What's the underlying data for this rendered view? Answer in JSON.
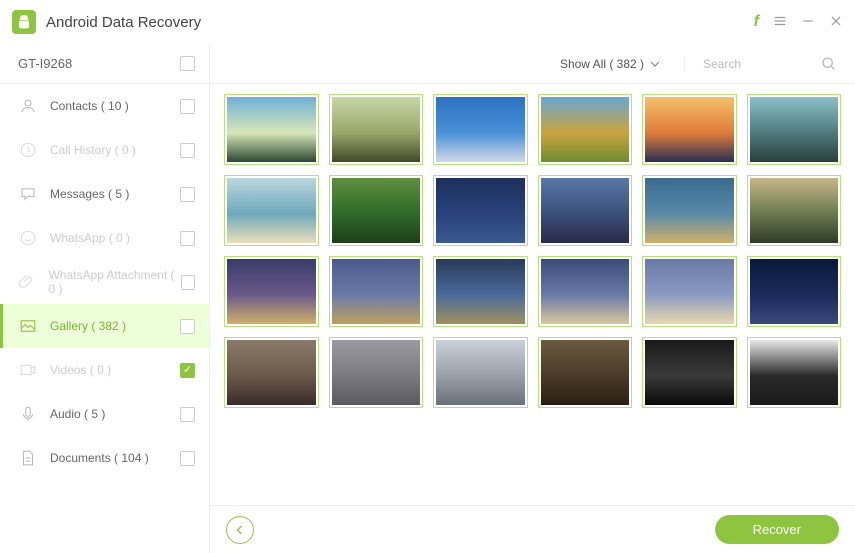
{
  "app": {
    "title": "Android Data Recovery"
  },
  "device": {
    "name": "GT-I9268",
    "checked": false
  },
  "sidebar": {
    "items": [
      {
        "label": "Contacts ( 10 )",
        "icon": "contacts",
        "disabled": false,
        "active": false,
        "checked": false
      },
      {
        "label": "Call History ( 0 )",
        "icon": "call-history",
        "disabled": true,
        "active": false,
        "checked": false
      },
      {
        "label": "Messages ( 5 )",
        "icon": "messages",
        "disabled": false,
        "active": false,
        "checked": false
      },
      {
        "label": "WhatsApp ( 0 )",
        "icon": "whatsapp",
        "disabled": true,
        "active": false,
        "checked": false
      },
      {
        "label": "WhatsApp Attachment ( 0 )",
        "icon": "attachment",
        "disabled": true,
        "active": false,
        "checked": false
      },
      {
        "label": "Gallery ( 382 )",
        "icon": "gallery",
        "disabled": false,
        "active": true,
        "checked": false
      },
      {
        "label": "Videos ( 0 )",
        "icon": "videos",
        "disabled": true,
        "active": false,
        "checked": true
      },
      {
        "label": "Audio ( 5 )",
        "icon": "audio",
        "disabled": false,
        "active": false,
        "checked": false
      },
      {
        "label": "Documents ( 104 )",
        "icon": "documents",
        "disabled": false,
        "active": false,
        "checked": false
      }
    ]
  },
  "toolbar": {
    "filter_label": "Show All ( 382 )",
    "search_placeholder": "Search"
  },
  "grid": {
    "thumbs": [
      {
        "name": "image-01",
        "g": [
          "#6fb0d8",
          "#d8e6b9",
          "#2a4a31"
        ]
      },
      {
        "name": "image-02",
        "g": [
          "#c7d7a6",
          "#9aa66a",
          "#3f4a2a"
        ]
      },
      {
        "name": "image-03",
        "g": [
          "#2c72c0",
          "#4a90d6",
          "#cfd9e6"
        ]
      },
      {
        "name": "image-04",
        "g": [
          "#6aa6d0",
          "#caa43f",
          "#6e8d33"
        ]
      },
      {
        "name": "image-05",
        "g": [
          "#f4c06a",
          "#e07c3a",
          "#2a2f52"
        ]
      },
      {
        "name": "image-06",
        "g": [
          "#8bc0c9",
          "#4f7a7d",
          "#2a3f3a"
        ]
      },
      {
        "name": "image-07",
        "g": [
          "#bcd6df",
          "#6ea9bb",
          "#eadfba"
        ]
      },
      {
        "name": "image-08",
        "g": [
          "#5f8f3f",
          "#2f6a2a",
          "#1e3d1a"
        ]
      },
      {
        "name": "image-09",
        "g": [
          "#1e2f5d",
          "#28427a",
          "#3a5a8f"
        ]
      },
      {
        "name": "image-10",
        "g": [
          "#5a78a8",
          "#3a4f78",
          "#2a2a4a"
        ]
      },
      {
        "name": "image-11",
        "g": [
          "#3a6a8f",
          "#5a8aa8",
          "#d0b06a"
        ]
      },
      {
        "name": "image-12",
        "g": [
          "#c7b68a",
          "#6a7a4f",
          "#2f3a2a"
        ]
      },
      {
        "name": "image-13",
        "g": [
          "#3a3a6a",
          "#6a5a8a",
          "#d0b06a"
        ]
      },
      {
        "name": "image-14",
        "g": [
          "#4a5a8a",
          "#6a7aa8",
          "#c0a060"
        ]
      },
      {
        "name": "image-15",
        "g": [
          "#2a3a5a",
          "#4a6a9a",
          "#a09060"
        ]
      },
      {
        "name": "image-16",
        "g": [
          "#3a4a7a",
          "#6a7aa8",
          "#d8c8a0"
        ]
      },
      {
        "name": "image-17",
        "g": [
          "#6a7aa8",
          "#8a9ac0",
          "#e8d8b0"
        ]
      },
      {
        "name": "image-18",
        "g": [
          "#0a1a3a",
          "#1a2a5a",
          "#3a4a7a"
        ]
      },
      {
        "name": "image-19",
        "g": [
          "#8a7a6a",
          "#6a5a4a",
          "#3a2a2a"
        ]
      },
      {
        "name": "image-20",
        "g": [
          "#9a9aa0",
          "#7a7a80",
          "#5a5a60"
        ]
      },
      {
        "name": "image-21",
        "g": [
          "#c8d0d8",
          "#9aa0a8",
          "#6a7078"
        ]
      },
      {
        "name": "image-22",
        "g": [
          "#6a5a40",
          "#4a3a28",
          "#2a1f14"
        ]
      },
      {
        "name": "image-23",
        "g": [
          "#1a1a1a",
          "#3a3a3a",
          "#0a0a0a"
        ]
      },
      {
        "name": "image-24",
        "g": [
          "#e8e8e8",
          "#2a2a2a",
          "#1a1a1a"
        ]
      }
    ]
  },
  "footer": {
    "recover_label": "Recover"
  },
  "colors": {
    "accent": "#8fc440"
  }
}
